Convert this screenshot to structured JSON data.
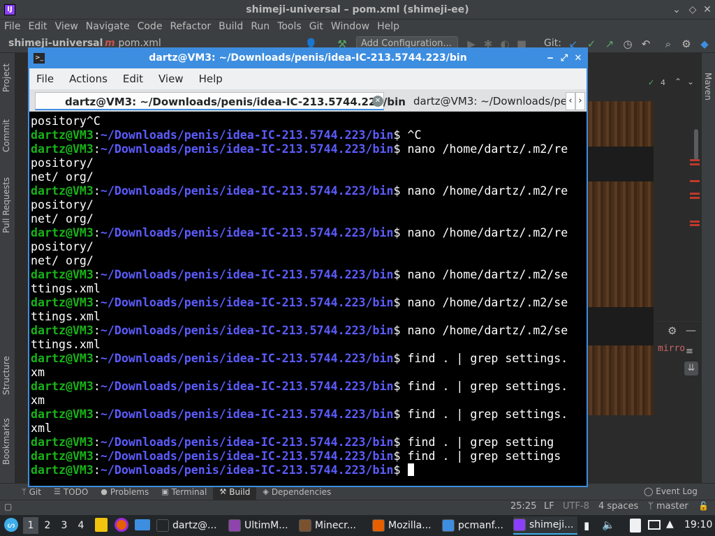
{
  "ide": {
    "title": "shimeji-universal – pom.xml (shimeji-ee)",
    "menu": [
      "File",
      "Edit",
      "View",
      "Navigate",
      "Code",
      "Refactor",
      "Build",
      "Run",
      "Tools",
      "Git",
      "Window",
      "Help"
    ],
    "navbar": {
      "project": "shimeji-universal",
      "file": "pom.xml",
      "add_configuration": "Add Configuration...",
      "git_label": "Git:"
    },
    "left_strip": [
      "Project",
      "Commit",
      "Pull Requests",
      "Structure",
      "Bookmarks"
    ],
    "right_strip": [
      "Maven"
    ],
    "editor": {
      "visible_text": "mirro",
      "gutter_count": "4"
    },
    "tool_tabs": [
      {
        "label": "Git",
        "icon": "git-branch-icon"
      },
      {
        "label": "TODO",
        "icon": "list-icon"
      },
      {
        "label": "Problems",
        "icon": "warning-icon"
      },
      {
        "label": "Terminal",
        "icon": "terminal-icon"
      },
      {
        "label": "Build",
        "icon": "hammer-icon",
        "active": true
      },
      {
        "label": "Dependencies",
        "icon": "layers-icon"
      }
    ],
    "event_log": "Event Log",
    "status": {
      "position": "25:25",
      "line_sep": "LF",
      "encoding": "UTF-8",
      "indent": "4 spaces",
      "branch": "master"
    }
  },
  "terminal": {
    "title": "dartz@VM3: ~/Downloads/penis/idea-IC-213.5744.223/bin",
    "menu": [
      "File",
      "Actions",
      "Edit",
      "View",
      "Help"
    ],
    "tabs": [
      {
        "label": "dartz@VM3: ~/Downloads/penis/idea-IC-213.5744.223/bin",
        "active": true
      },
      {
        "label": "dartz@VM3: ~/Downloads/penis/idea-IC-213.5744.223/bin",
        "active": false
      }
    ],
    "prompt_user": "dartz@VM3",
    "prompt_colon": ":",
    "prompt_path": "~/Downloads/penis/idea-IC-213.5744.223/bin",
    "prompt_dollar": "$ ",
    "lines": [
      {
        "type": "out",
        "text": "pository^C"
      },
      {
        "type": "cmd",
        "text": "^C"
      },
      {
        "type": "cmd",
        "text": "nano /home/dartz/.m2/re"
      },
      {
        "type": "out",
        "text": "pository/"
      },
      {
        "type": "out",
        "text": "net/ org/"
      },
      {
        "type": "cmd",
        "text": "nano /home/dartz/.m2/re"
      },
      {
        "type": "out",
        "text": "pository/"
      },
      {
        "type": "out",
        "text": "net/ org/"
      },
      {
        "type": "cmd",
        "text": "nano /home/dartz/.m2/re"
      },
      {
        "type": "out",
        "text": "pository/"
      },
      {
        "type": "out",
        "text": "net/ org/"
      },
      {
        "type": "cmd",
        "text": "nano /home/dartz/.m2/se"
      },
      {
        "type": "out",
        "text": "ttings.xml"
      },
      {
        "type": "cmd",
        "text": "nano /home/dartz/.m2/se"
      },
      {
        "type": "out",
        "text": "ttings.xml"
      },
      {
        "type": "cmd",
        "text": "nano /home/dartz/.m2/se"
      },
      {
        "type": "out",
        "text": "ttings.xml"
      },
      {
        "type": "cmd",
        "text": "find . | grep settings."
      },
      {
        "type": "out",
        "text": "xm"
      },
      {
        "type": "cmd",
        "text": "find . | grep settings."
      },
      {
        "type": "out",
        "text": "xm"
      },
      {
        "type": "cmd",
        "text": "find . | grep settings."
      },
      {
        "type": "out",
        "text": "xml"
      },
      {
        "type": "cmd",
        "text": "find . | grep setting"
      },
      {
        "type": "cmd",
        "text": "find . | grep settings"
      },
      {
        "type": "cmd",
        "text": "",
        "cursor": true
      }
    ]
  },
  "taskbar": {
    "desktops": [
      "1",
      "2",
      "3",
      "4"
    ],
    "tasks": [
      {
        "label": "dartz@...",
        "color": "#232627",
        "active": false
      },
      {
        "label": "UltimM...",
        "color": "#8e44ad",
        "active": false
      },
      {
        "label": "Minecr...",
        "color": "#7a5230",
        "active": false
      },
      {
        "label": "Mozilla...",
        "color": "#e66000",
        "active": false
      },
      {
        "label": "pcmanf...",
        "color": "#3d8ee0",
        "active": false
      },
      {
        "label": "shimeji...",
        "color": "#8a3ffc",
        "active": true
      }
    ],
    "clock": "19:10"
  },
  "colors": {
    "prompt_user": "#18b218",
    "prompt_path": "#5c5cff",
    "window_accent": "#3d8ee0",
    "ide_bg": "#3c3f41"
  }
}
